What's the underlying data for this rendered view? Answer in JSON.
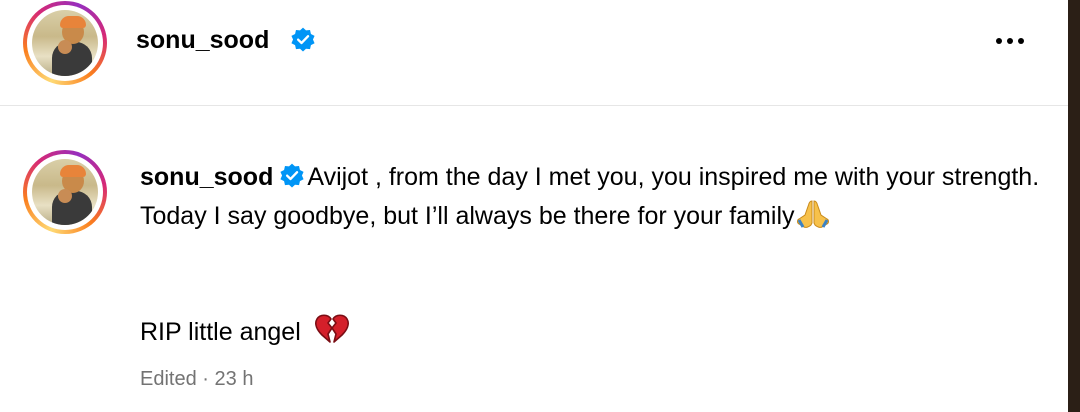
{
  "post": {
    "header": {
      "username": "sonu_sood",
      "verified": true
    },
    "caption": {
      "username": "sonu_sood",
      "text_main": "Avijot , from the day I met you, you inspired me with your strength. Today I say goodbye, but I’ll always be there for your family",
      "text_line2": "RIP little angel"
    },
    "meta": {
      "edited_label": "Edited",
      "separator": "·",
      "time": "23 h"
    },
    "icons": {
      "verified": "verified-badge-icon",
      "more": "more-options-icon",
      "praying_hands": "folded-hands-emoji",
      "broken_heart": "broken-heart-emoji"
    },
    "colors": {
      "verified_blue": "#0095f6",
      "meta_gray": "#737373",
      "divider": "#e6e6e6"
    }
  }
}
